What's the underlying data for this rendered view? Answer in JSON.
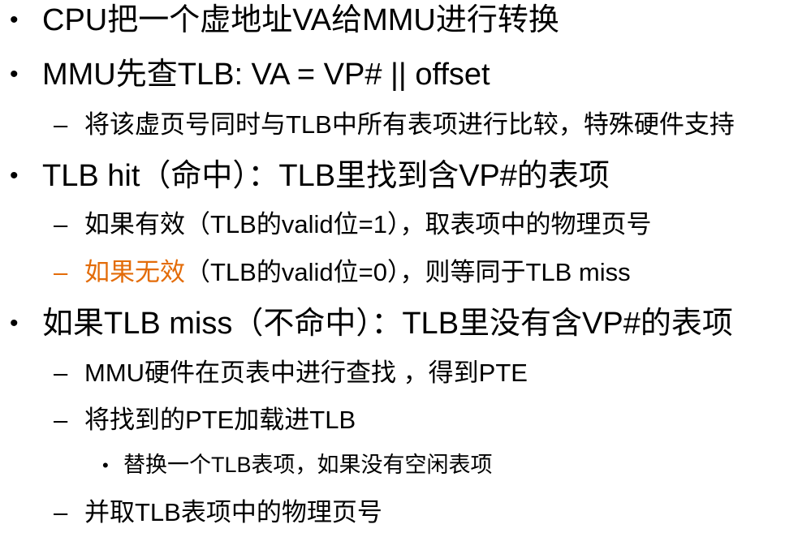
{
  "colors": {
    "text": "#000000",
    "accent": "#e36c09"
  },
  "icons": {
    "bullet": "•",
    "dash": "–"
  },
  "items": [
    {
      "text": "CPU把一个虚地址VA给MMU进行转换"
    },
    {
      "text": "MMU先查TLB: VA = VP# || offset"
    },
    {
      "text": "将该虚页号同时与TLB中所有表项进行比较，特殊硬件支持"
    },
    {
      "text": "TLB hit（命中）：TLB里找到含VP#的表项"
    },
    {
      "text": "如果有效（TLB的valid位=1），取表项中的物理页号"
    },
    {
      "highlight": "如果无效",
      "text": "（TLB的valid位=0），则等同于TLB miss"
    },
    {
      "text": "如果TLB miss（不命中）：TLB里没有含VP#的表项"
    },
    {
      "text": "MMU硬件在页表中进行查找 ，得到PTE"
    },
    {
      "text": "将找到的PTE加载进TLB"
    },
    {
      "text": "替换一个TLB表项，如果没有空闲表项"
    },
    {
      "text": "并取TLB表项中的物理页号"
    }
  ]
}
